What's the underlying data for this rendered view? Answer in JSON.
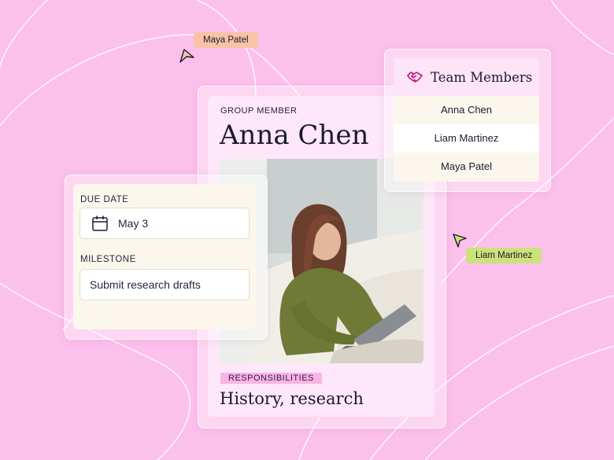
{
  "member_card": {
    "eyebrow": "GROUP MEMBER",
    "name": "Anna Chen",
    "responsibilities_label": "RESPONSIBILITIES",
    "responsibilities": "History, research"
  },
  "task_card": {
    "due_label": "DUE DATE",
    "due_value": "May 3",
    "milestone_label": "MILESTONE",
    "milestone_value": "Submit research drafts"
  },
  "team": {
    "title": "Team Members",
    "members": [
      "Anna Chen",
      "Liam Martinez",
      "Maya Patel"
    ]
  },
  "cursors": {
    "maya": "Maya Patel",
    "liam": "Liam Martinez"
  },
  "colors": {
    "background": "#fcc0ec",
    "card_pink": "#fde7f9",
    "card_cream": "#fcf7ec",
    "maya_cursor": "#f9c3a6",
    "liam_cursor": "#cbe27a",
    "accent_magenta": "#c2187a"
  },
  "icons": {
    "calendar": "calendar-icon",
    "team": "handshake-icon",
    "cursor": "cursor-arrow-icon"
  }
}
